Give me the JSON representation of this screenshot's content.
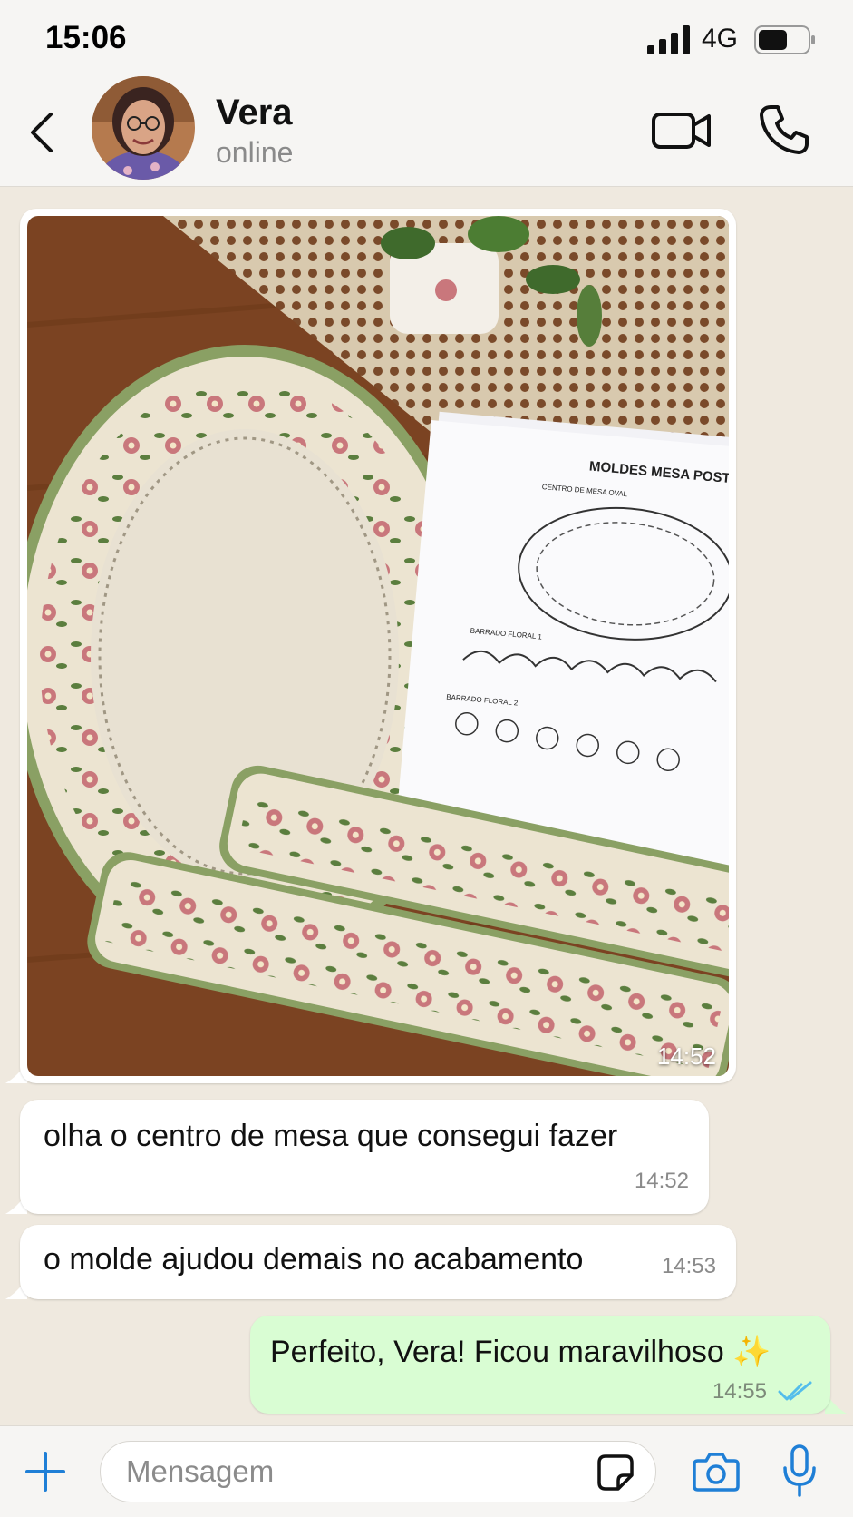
{
  "status_bar": {
    "time": "15:06",
    "network": "4G",
    "battery_level": 0.55,
    "icons": [
      "signal-bars-icon",
      "battery-icon"
    ]
  },
  "header": {
    "name": "Vera",
    "status": "online",
    "icons": [
      "back-chevron-icon",
      "video-call-icon",
      "phone-icon"
    ]
  },
  "messages": [
    {
      "type": "image",
      "direction": "incoming",
      "time": "14:52",
      "photo_text": {
        "title": "MOLDES MESA POSTA",
        "sheet_label_1": "CENTRO DE MESA OVAL",
        "sheet_label_2": "BARRADO FLORAL 1",
        "sheet_label_3": "BARRADO FLORAL 2"
      }
    },
    {
      "type": "text",
      "direction": "incoming",
      "text": "olha o centro de mesa que consegui fazer",
      "time": "14:52"
    },
    {
      "type": "text",
      "direction": "incoming",
      "text": "o molde ajudou demais no acabamento",
      "time": "14:53"
    },
    {
      "type": "text",
      "direction": "outgoing",
      "text": "Perfeito, Vera! Ficou maravilhoso ✨",
      "time": "14:55",
      "read": true
    }
  ],
  "input_bar": {
    "placeholder": "Mensagem",
    "icons": [
      "plus-icon",
      "sticker-icon",
      "camera-icon",
      "microphone-icon"
    ]
  },
  "colors": {
    "accent": "#1f7fd6",
    "outgoing_bubble": "#d9fdd3",
    "chat_background": "#efe9df",
    "read_ticks": "#53bdeb"
  }
}
